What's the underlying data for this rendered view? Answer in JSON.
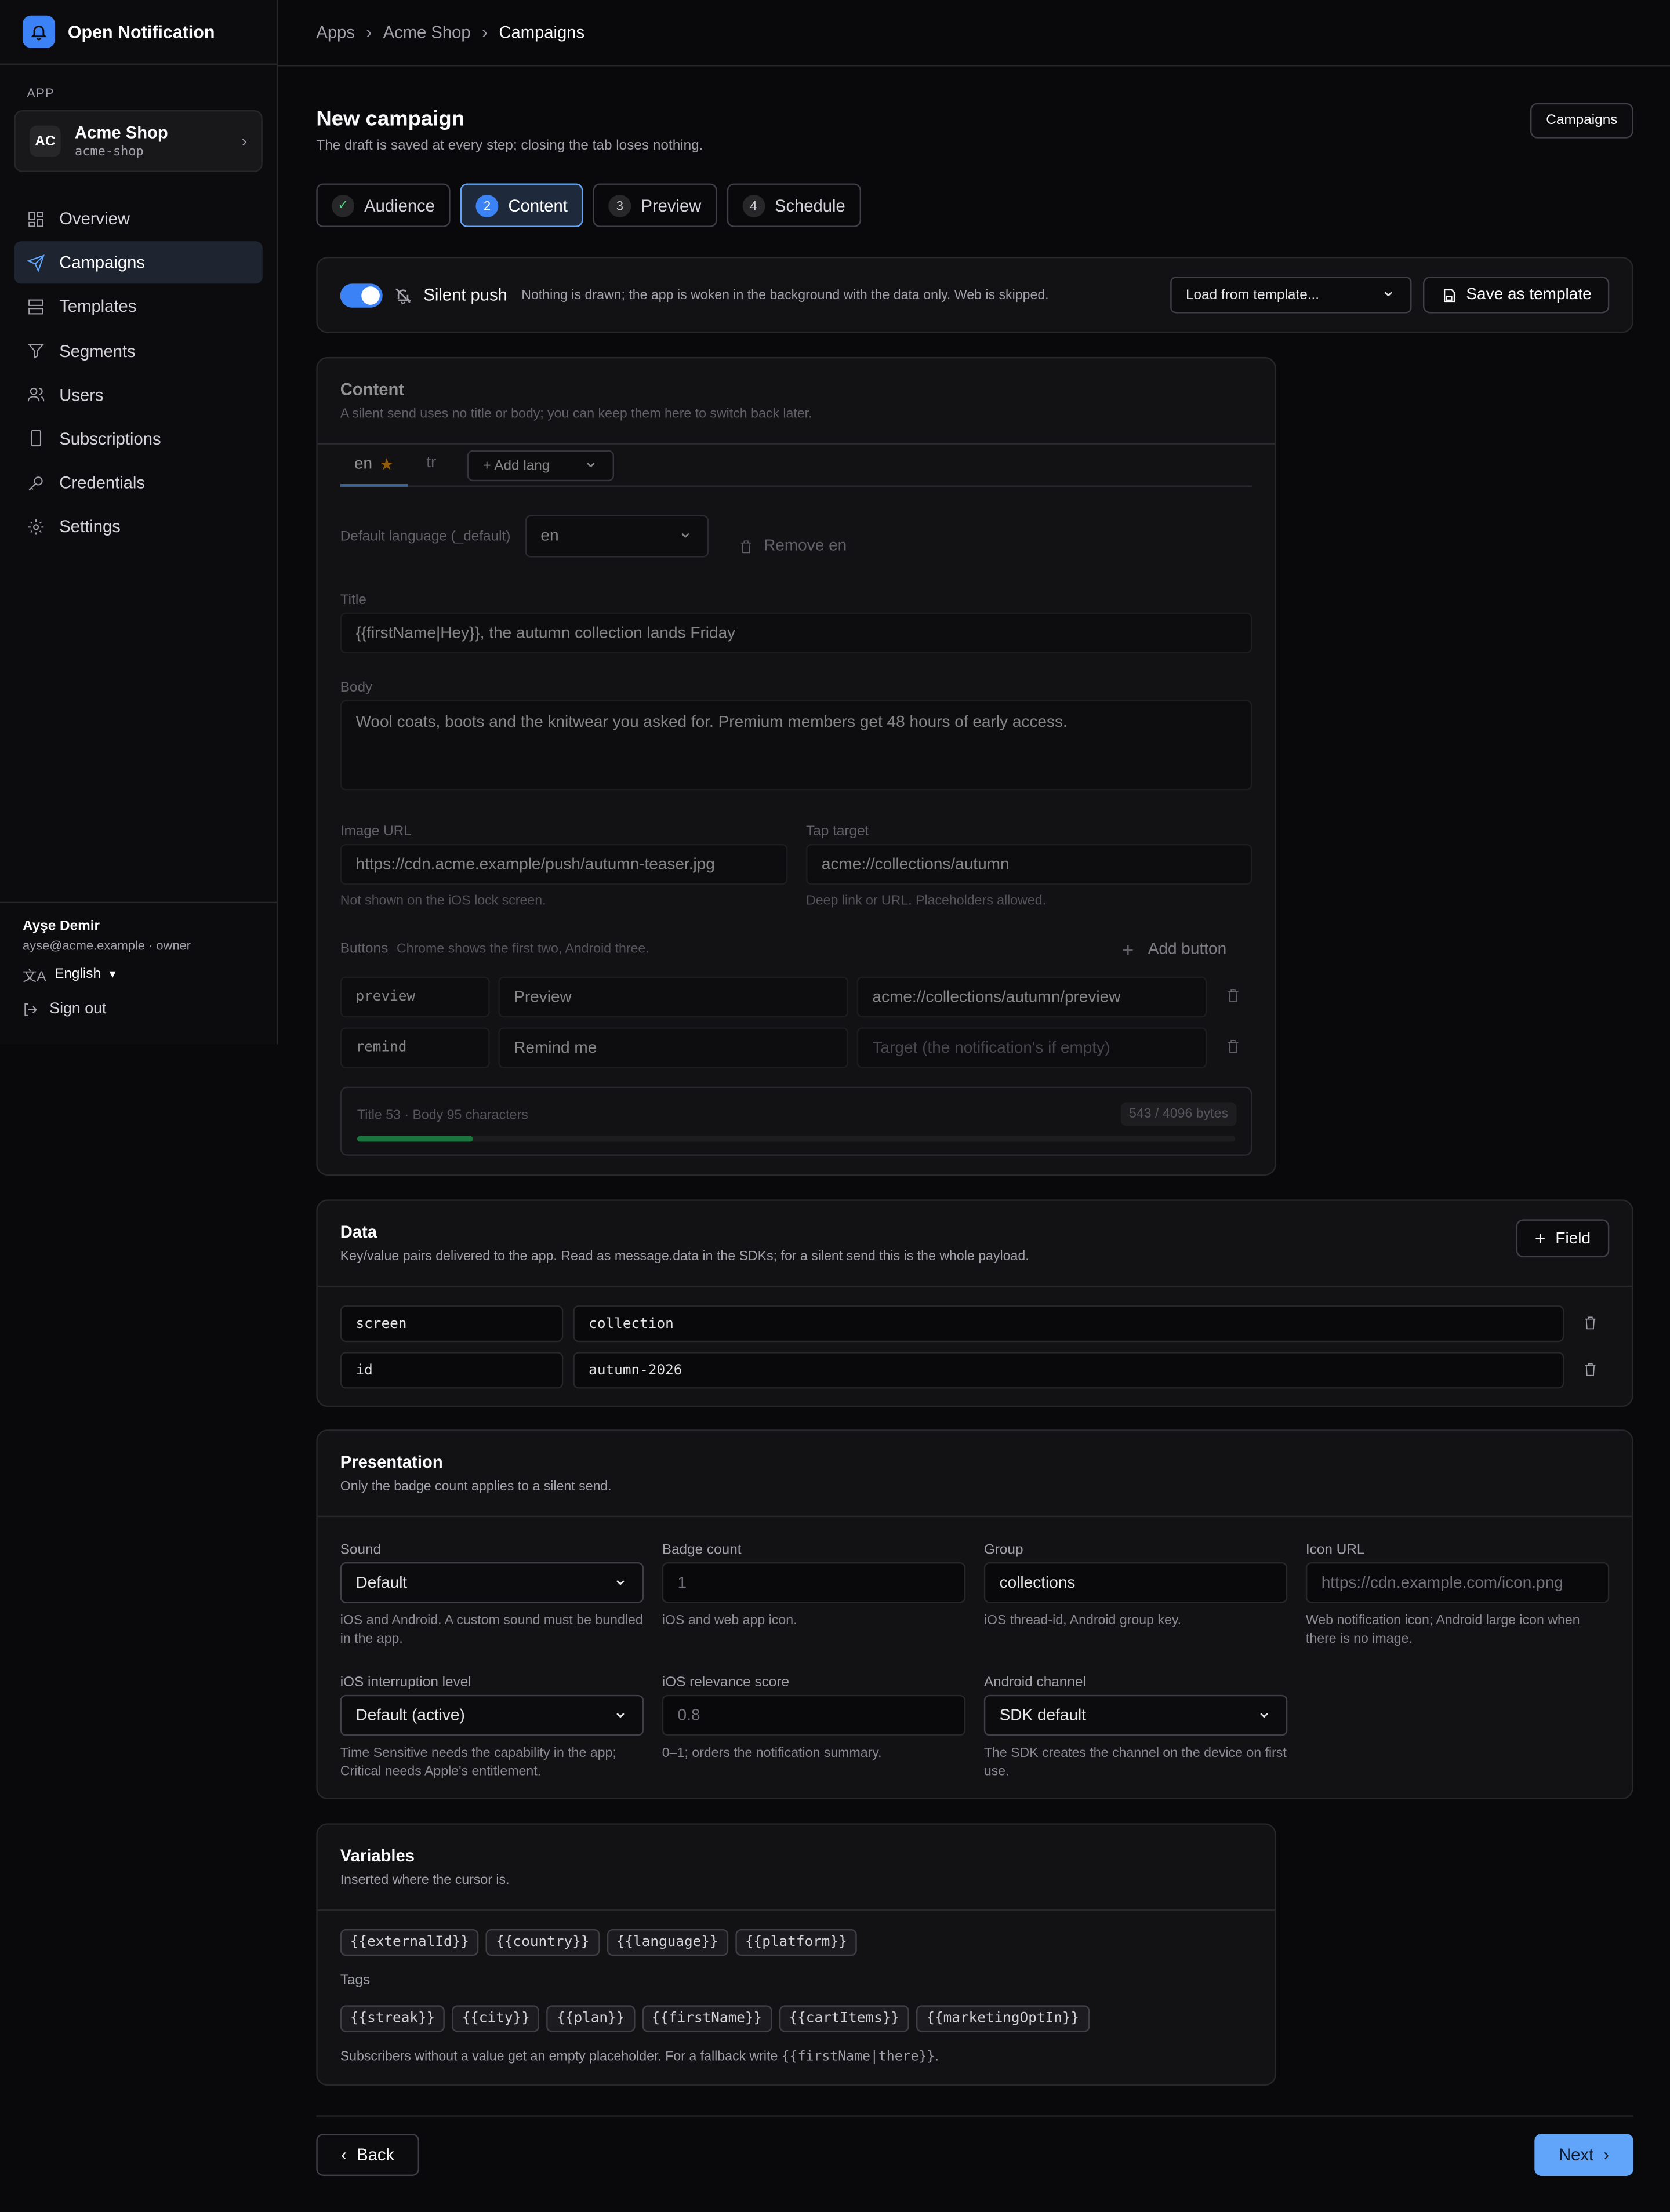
{
  "brand": {
    "name": "Open Notification"
  },
  "sidebar": {
    "section_label": "APP",
    "app": {
      "initials": "AC",
      "name": "Acme Shop",
      "slug": "acme-shop"
    },
    "items": [
      {
        "label": "Overview",
        "icon": "grid-icon"
      },
      {
        "label": "Campaigns",
        "icon": "send-icon",
        "active": true
      },
      {
        "label": "Templates",
        "icon": "template-icon"
      },
      {
        "label": "Segments",
        "icon": "filter-icon"
      },
      {
        "label": "Users",
        "icon": "users-icon"
      },
      {
        "label": "Subscriptions",
        "icon": "device-icon"
      },
      {
        "label": "Credentials",
        "icon": "key-icon"
      },
      {
        "label": "Settings",
        "icon": "gear-icon"
      }
    ],
    "user": {
      "name": "Ayşe Demir",
      "sub": "ayse@acme.example · owner",
      "language": "English",
      "signout": "Sign out"
    }
  },
  "breadcrumb": [
    "Apps",
    "Acme Shop",
    "Campaigns"
  ],
  "page": {
    "title": "New campaign",
    "subtitle": "The draft is saved at every step; closing the tab loses nothing.",
    "campaigns_button": "Campaigns"
  },
  "steps": [
    {
      "label": "Audience",
      "num": "✓",
      "state": "done"
    },
    {
      "label": "Content",
      "num": "2",
      "state": "active"
    },
    {
      "label": "Preview",
      "num": "3",
      "state": "todo"
    },
    {
      "label": "Schedule",
      "num": "4",
      "state": "todo"
    }
  ],
  "silent": {
    "label": "Silent push",
    "on": true,
    "desc": "Nothing is drawn; the app is woken in the background with the data only. Web is skipped.",
    "template_select": "Load from template...",
    "save_template": "Save as template"
  },
  "content": {
    "title": "Content",
    "subtitle": "A silent send uses no title or body; you can keep them here to switch back later.",
    "lang_tabs": [
      "en",
      "tr"
    ],
    "add_language": "+ Add lang",
    "default_language_label": "Default language (_default)",
    "default_language_value": "en",
    "remove_label": "Remove en",
    "title_label": "Title",
    "title_value": "{{firstName|Hey}}, the autumn collection lands Friday",
    "body_label": "Body",
    "body_value": "Wool coats, boots and the knitwear you asked for. Premium members get 48 hours of early access.",
    "image_label": "Image URL",
    "image_value": "https://cdn.acme.example/push/autumn-teaser.jpg",
    "image_hint": "Not shown on the iOS lock screen.",
    "tap_label": "Tap target",
    "tap_value": "acme://collections/autumn",
    "tap_hint": "Deep link or URL. Placeholders allowed.",
    "buttons_label": "Buttons",
    "buttons_hint": "Chrome shows the first two, Android three.",
    "add_button": "Add button",
    "buttons": [
      {
        "id": "preview",
        "label": "Preview",
        "target": "acme://collections/autumn/preview",
        "target_placeholder": ""
      },
      {
        "id": "remind",
        "label": "Remind me",
        "target": "",
        "target_placeholder": "Target (the notification's if empty)"
      }
    ],
    "stats": "Title 53 · Body 95 characters",
    "bytes": "543 / 4096 bytes",
    "bytes_fraction": 0.1326
  },
  "data_section": {
    "title": "Data",
    "subtitle": "Key/value pairs delivered to the app. Read as message.data in the SDKs; for a silent send this is the whole payload.",
    "add_field": "Field",
    "rows": [
      {
        "key": "screen",
        "value": "collection"
      },
      {
        "key": "id",
        "value": "autumn-2026"
      }
    ]
  },
  "presentation": {
    "title": "Presentation",
    "subtitle": "Only the badge count applies to a silent send.",
    "sound": {
      "label": "Sound",
      "value": "Default",
      "hint": "iOS and Android. A custom sound must be bundled in the app."
    },
    "badge": {
      "label": "Badge count",
      "placeholder": "1",
      "hint": "iOS and web app icon."
    },
    "group": {
      "label": "Group",
      "value": "collections",
      "hint": "iOS thread-id, Android group key."
    },
    "icon": {
      "label": "Icon URL",
      "placeholder": "https://cdn.example.com/icon.png",
      "hint": "Web notification icon; Android large icon when there is no image."
    },
    "interruption": {
      "label": "iOS interruption level",
      "value": "Default (active)",
      "hint": "Time Sensitive needs the capability in the app; Critical needs Apple's entitlement."
    },
    "relevance": {
      "label": "iOS relevance score",
      "placeholder": "0.8",
      "hint": "0–1; orders the notification summary."
    },
    "channel": {
      "label": "Android channel",
      "value": "SDK default",
      "hint": "The SDK creates the channel on the device on first use."
    }
  },
  "variables": {
    "title": "Variables",
    "subtitle": "Inserted where the cursor is.",
    "builtins": [
      "{{externalId}}",
      "{{country}}",
      "{{language}}",
      "{{platform}}"
    ],
    "tags_label": "Tags",
    "tags": [
      "{{streak}}",
      "{{city}}",
      "{{plan}}",
      "{{firstName}}",
      "{{cartItems}}",
      "{{marketingOptIn}}"
    ],
    "footnote_pre": "Subscribers without a value get an empty placeholder. For a fallback write",
    "footnote_code": "{{firstName|there}}",
    "footnote_post": "."
  },
  "footer": {
    "back": "Back",
    "next": "Next"
  }
}
